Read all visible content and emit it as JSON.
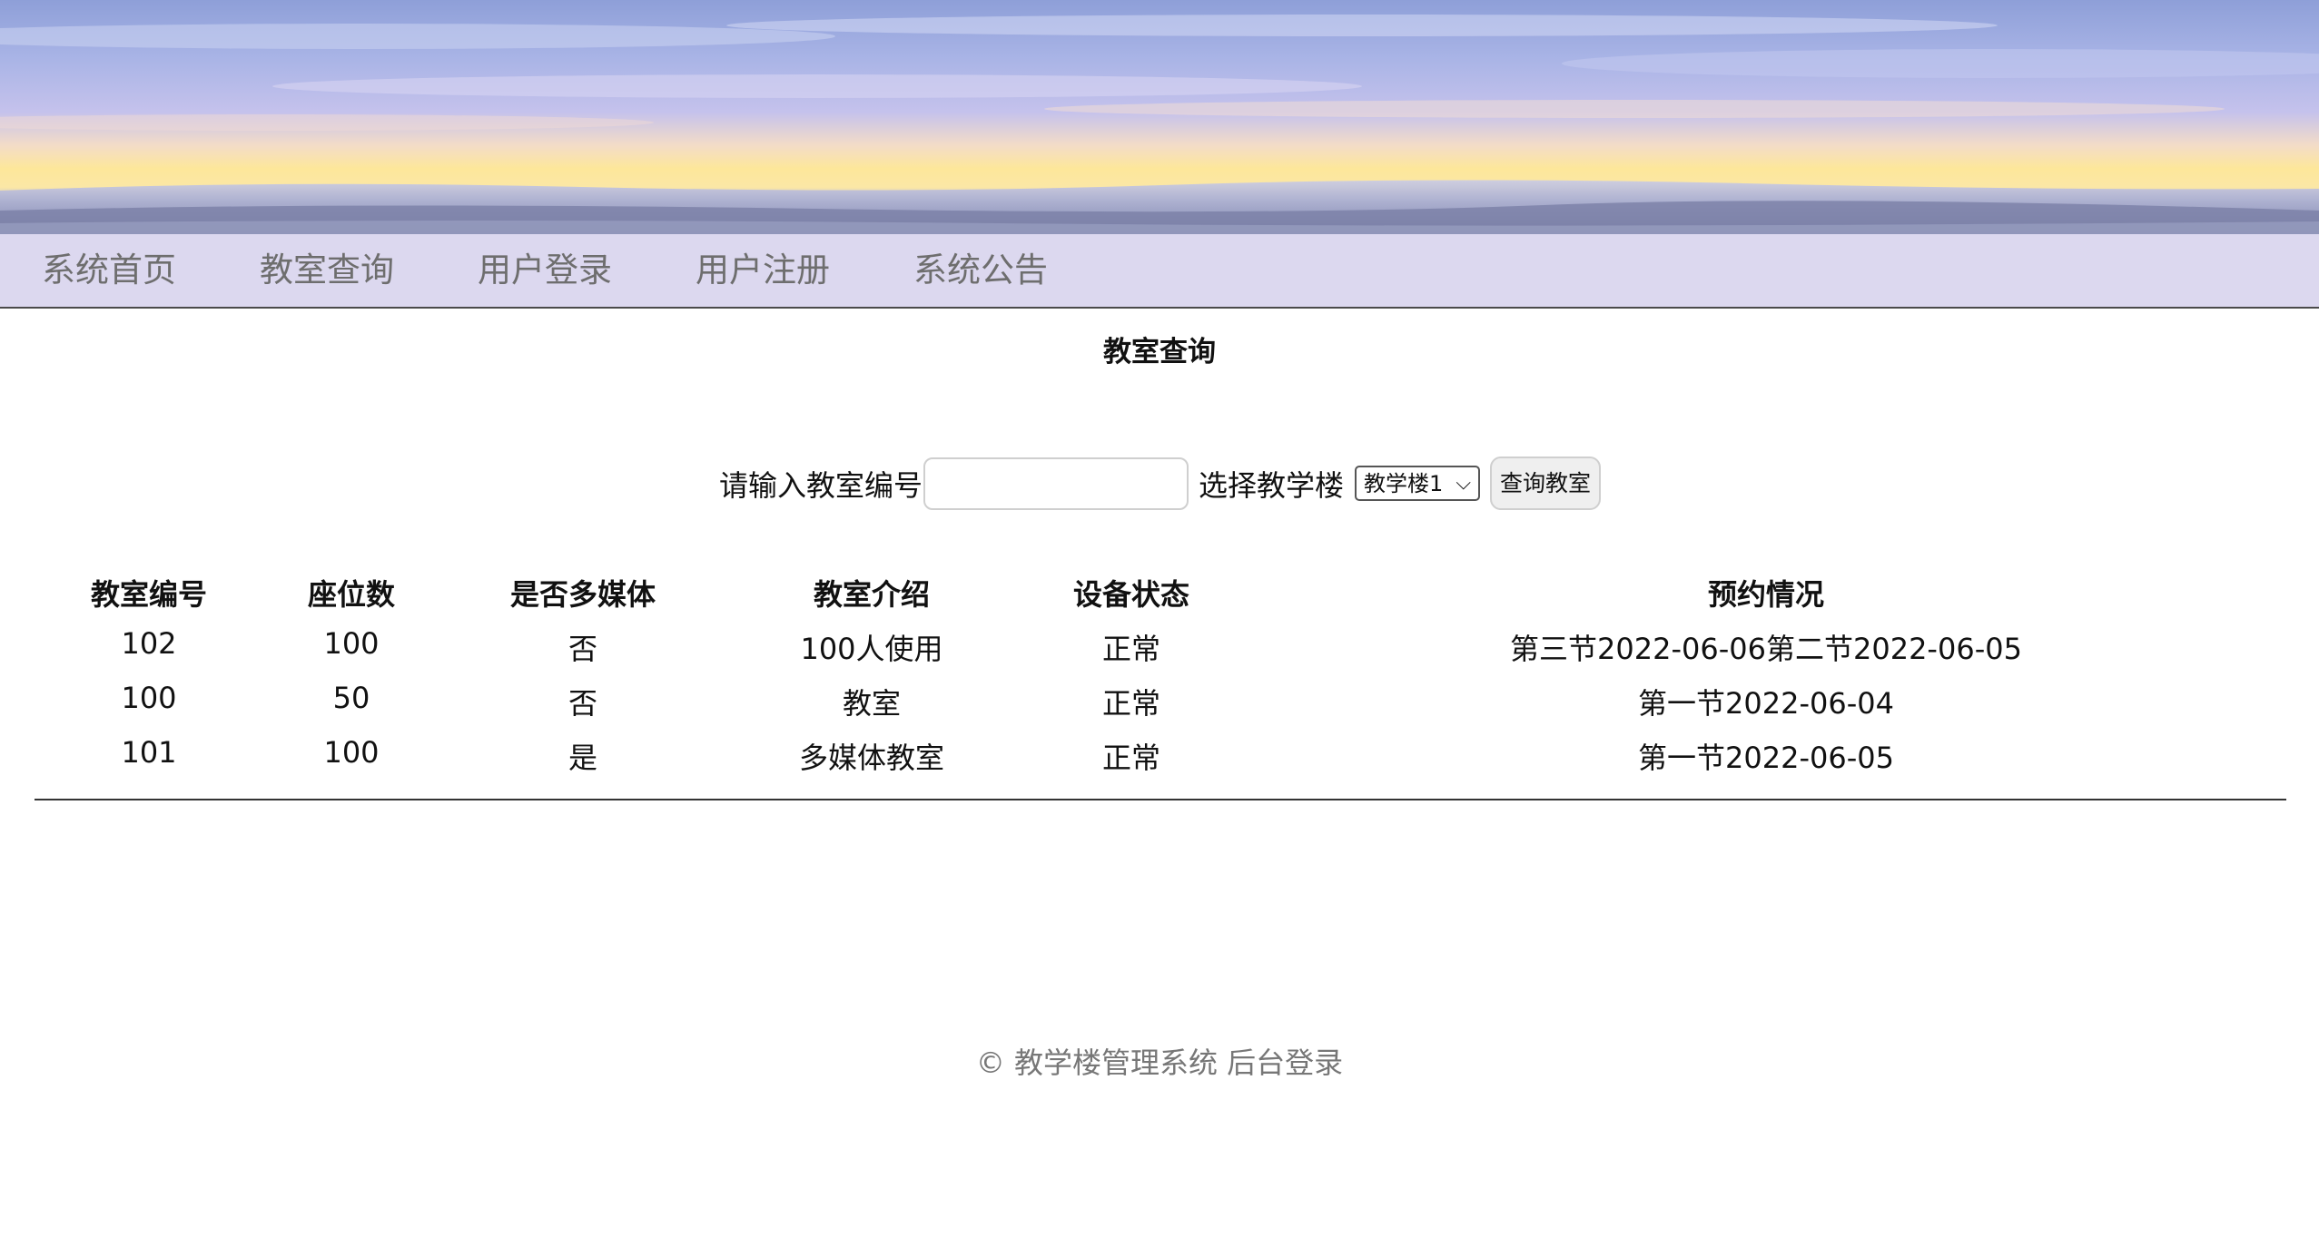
{
  "nav": {
    "items": [
      "系统首页",
      "教室查询",
      "用户登录",
      "用户注册",
      "系统公告"
    ]
  },
  "page_title": "教室查询",
  "search": {
    "room_label": "请输入教室编号",
    "room_value": "",
    "room_placeholder": "",
    "building_label": "选择教学楼",
    "building_selected": "教学楼1",
    "query_button": "查询教室"
  },
  "table": {
    "headers": [
      "教室编号",
      "座位数",
      "是否多媒体",
      "教室介绍",
      "设备状态",
      "预约情况"
    ],
    "rows": [
      [
        "102",
        "100",
        "否",
        "100人使用",
        "正常",
        "第三节2022-06-06第二节2022-06-05"
      ],
      [
        "100",
        "50",
        "否",
        "教室",
        "正常",
        "第一节2022-06-04"
      ],
      [
        "101",
        "100",
        "是",
        "多媒体教室",
        "正常",
        "第一节2022-06-05"
      ]
    ]
  },
  "footer": {
    "copyright": "© 教学楼管理系统",
    "admin_login": "后台登录"
  },
  "colors": {
    "nav_bg": "#dcd8ef",
    "nav_text": "#6e6e6e",
    "footer_text": "#777777"
  }
}
